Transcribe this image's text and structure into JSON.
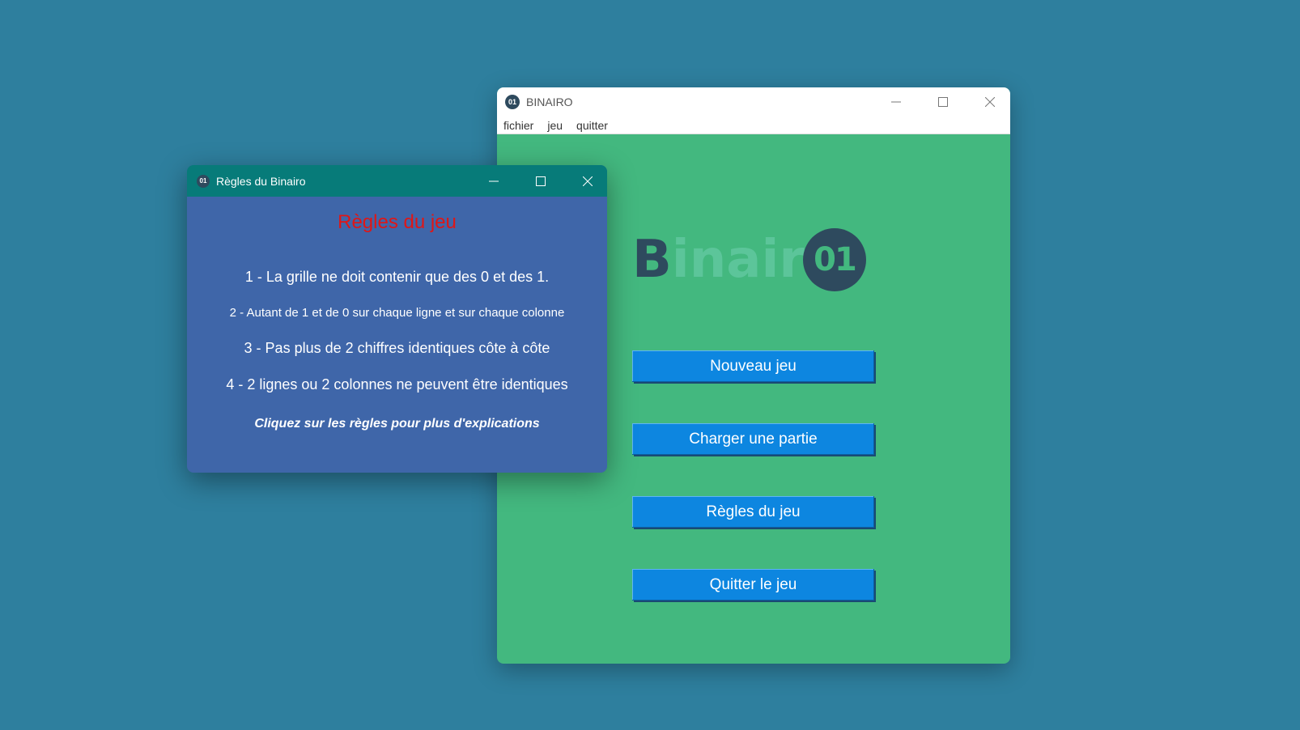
{
  "main_window": {
    "title": "BINAIRO",
    "app_icon_text": "01",
    "menu": [
      "fichier",
      "jeu",
      "quitter"
    ],
    "logo": {
      "text_dark": "B",
      "text_light": "inair",
      "circle_text": "01",
      "colors": {
        "dark": "#2e4a5e",
        "light": "#5cc59a"
      }
    },
    "buttons": {
      "new_game": "Nouveau jeu",
      "load_game": "Charger une partie",
      "rules": "Règles du jeu",
      "quit": "Quitter le jeu"
    }
  },
  "rules_window": {
    "title": "Règles du Binairo",
    "app_icon_text": "01",
    "heading": "Règles du jeu",
    "rules": [
      "1 - La grille ne doit contenir que des 0 et des 1.",
      "2 - Autant de 1 et de 0 sur chaque ligne et sur chaque colonne",
      "3 - Pas plus de 2 chiffres identiques côte à côte",
      "4 - 2 lignes ou 2 colonnes ne peuvent être identiques"
    ],
    "hint": "Cliquez sur les règles pour plus d'explications"
  },
  "colors": {
    "desktop": "#2e7f9e",
    "main_bg": "#43b87f",
    "rules_bg": "#3f66a9",
    "rules_titlebar": "#077b79",
    "button": "#0d86e0",
    "heading_red": "#e01616"
  },
  "icons": [
    "minimize-icon",
    "maximize-icon",
    "close-icon"
  ]
}
